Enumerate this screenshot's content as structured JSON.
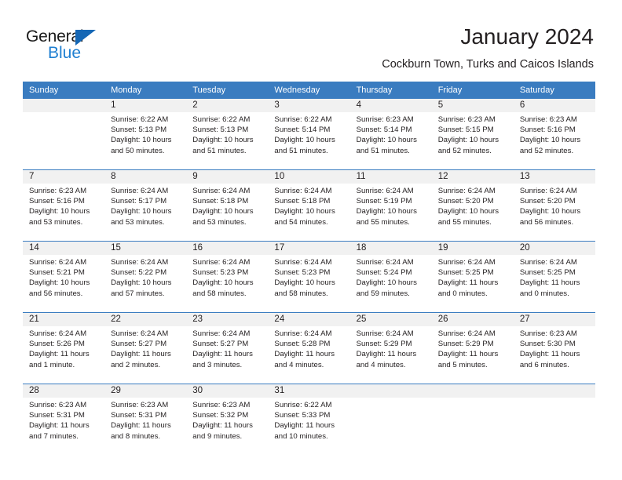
{
  "brand": {
    "name_top": "General",
    "name_bottom": "Blue",
    "triangle_color": "#1567b5",
    "blue_color": "#1f7fd1"
  },
  "header": {
    "title": "January 2024",
    "subtitle": "Cockburn Town, Turks and Caicos Islands"
  },
  "theme": {
    "header_row_bg": "#3a7cc0",
    "daynum_bg": "#f1f1f1",
    "text": "#231f20"
  },
  "weekday_headers": [
    "Sunday",
    "Monday",
    "Tuesday",
    "Wednesday",
    "Thursday",
    "Friday",
    "Saturday"
  ],
  "weeks": [
    [
      {
        "day": "",
        "sunrise": "",
        "sunset": "",
        "daylight_line1": "",
        "daylight_line2": ""
      },
      {
        "day": "1",
        "sunrise": "Sunrise: 6:22 AM",
        "sunset": "Sunset: 5:13 PM",
        "daylight_line1": "Daylight: 10 hours",
        "daylight_line2": "and 50 minutes."
      },
      {
        "day": "2",
        "sunrise": "Sunrise: 6:22 AM",
        "sunset": "Sunset: 5:13 PM",
        "daylight_line1": "Daylight: 10 hours",
        "daylight_line2": "and 51 minutes."
      },
      {
        "day": "3",
        "sunrise": "Sunrise: 6:22 AM",
        "sunset": "Sunset: 5:14 PM",
        "daylight_line1": "Daylight: 10 hours",
        "daylight_line2": "and 51 minutes."
      },
      {
        "day": "4",
        "sunrise": "Sunrise: 6:23 AM",
        "sunset": "Sunset: 5:14 PM",
        "daylight_line1": "Daylight: 10 hours",
        "daylight_line2": "and 51 minutes."
      },
      {
        "day": "5",
        "sunrise": "Sunrise: 6:23 AM",
        "sunset": "Sunset: 5:15 PM",
        "daylight_line1": "Daylight: 10 hours",
        "daylight_line2": "and 52 minutes."
      },
      {
        "day": "6",
        "sunrise": "Sunrise: 6:23 AM",
        "sunset": "Sunset: 5:16 PM",
        "daylight_line1": "Daylight: 10 hours",
        "daylight_line2": "and 52 minutes."
      }
    ],
    [
      {
        "day": "7",
        "sunrise": "Sunrise: 6:23 AM",
        "sunset": "Sunset: 5:16 PM",
        "daylight_line1": "Daylight: 10 hours",
        "daylight_line2": "and 53 minutes."
      },
      {
        "day": "8",
        "sunrise": "Sunrise: 6:24 AM",
        "sunset": "Sunset: 5:17 PM",
        "daylight_line1": "Daylight: 10 hours",
        "daylight_line2": "and 53 minutes."
      },
      {
        "day": "9",
        "sunrise": "Sunrise: 6:24 AM",
        "sunset": "Sunset: 5:18 PM",
        "daylight_line1": "Daylight: 10 hours",
        "daylight_line2": "and 53 minutes."
      },
      {
        "day": "10",
        "sunrise": "Sunrise: 6:24 AM",
        "sunset": "Sunset: 5:18 PM",
        "daylight_line1": "Daylight: 10 hours",
        "daylight_line2": "and 54 minutes."
      },
      {
        "day": "11",
        "sunrise": "Sunrise: 6:24 AM",
        "sunset": "Sunset: 5:19 PM",
        "daylight_line1": "Daylight: 10 hours",
        "daylight_line2": "and 55 minutes."
      },
      {
        "day": "12",
        "sunrise": "Sunrise: 6:24 AM",
        "sunset": "Sunset: 5:20 PM",
        "daylight_line1": "Daylight: 10 hours",
        "daylight_line2": "and 55 minutes."
      },
      {
        "day": "13",
        "sunrise": "Sunrise: 6:24 AM",
        "sunset": "Sunset: 5:20 PM",
        "daylight_line1": "Daylight: 10 hours",
        "daylight_line2": "and 56 minutes."
      }
    ],
    [
      {
        "day": "14",
        "sunrise": "Sunrise: 6:24 AM",
        "sunset": "Sunset: 5:21 PM",
        "daylight_line1": "Daylight: 10 hours",
        "daylight_line2": "and 56 minutes."
      },
      {
        "day": "15",
        "sunrise": "Sunrise: 6:24 AM",
        "sunset": "Sunset: 5:22 PM",
        "daylight_line1": "Daylight: 10 hours",
        "daylight_line2": "and 57 minutes."
      },
      {
        "day": "16",
        "sunrise": "Sunrise: 6:24 AM",
        "sunset": "Sunset: 5:23 PM",
        "daylight_line1": "Daylight: 10 hours",
        "daylight_line2": "and 58 minutes."
      },
      {
        "day": "17",
        "sunrise": "Sunrise: 6:24 AM",
        "sunset": "Sunset: 5:23 PM",
        "daylight_line1": "Daylight: 10 hours",
        "daylight_line2": "and 58 minutes."
      },
      {
        "day": "18",
        "sunrise": "Sunrise: 6:24 AM",
        "sunset": "Sunset: 5:24 PM",
        "daylight_line1": "Daylight: 10 hours",
        "daylight_line2": "and 59 minutes."
      },
      {
        "day": "19",
        "sunrise": "Sunrise: 6:24 AM",
        "sunset": "Sunset: 5:25 PM",
        "daylight_line1": "Daylight: 11 hours",
        "daylight_line2": "and 0 minutes."
      },
      {
        "day": "20",
        "sunrise": "Sunrise: 6:24 AM",
        "sunset": "Sunset: 5:25 PM",
        "daylight_line1": "Daylight: 11 hours",
        "daylight_line2": "and 0 minutes."
      }
    ],
    [
      {
        "day": "21",
        "sunrise": "Sunrise: 6:24 AM",
        "sunset": "Sunset: 5:26 PM",
        "daylight_line1": "Daylight: 11 hours",
        "daylight_line2": "and 1 minute."
      },
      {
        "day": "22",
        "sunrise": "Sunrise: 6:24 AM",
        "sunset": "Sunset: 5:27 PM",
        "daylight_line1": "Daylight: 11 hours",
        "daylight_line2": "and 2 minutes."
      },
      {
        "day": "23",
        "sunrise": "Sunrise: 6:24 AM",
        "sunset": "Sunset: 5:27 PM",
        "daylight_line1": "Daylight: 11 hours",
        "daylight_line2": "and 3 minutes."
      },
      {
        "day": "24",
        "sunrise": "Sunrise: 6:24 AM",
        "sunset": "Sunset: 5:28 PM",
        "daylight_line1": "Daylight: 11 hours",
        "daylight_line2": "and 4 minutes."
      },
      {
        "day": "25",
        "sunrise": "Sunrise: 6:24 AM",
        "sunset": "Sunset: 5:29 PM",
        "daylight_line1": "Daylight: 11 hours",
        "daylight_line2": "and 4 minutes."
      },
      {
        "day": "26",
        "sunrise": "Sunrise: 6:24 AM",
        "sunset": "Sunset: 5:29 PM",
        "daylight_line1": "Daylight: 11 hours",
        "daylight_line2": "and 5 minutes."
      },
      {
        "day": "27",
        "sunrise": "Sunrise: 6:23 AM",
        "sunset": "Sunset: 5:30 PM",
        "daylight_line1": "Daylight: 11 hours",
        "daylight_line2": "and 6 minutes."
      }
    ],
    [
      {
        "day": "28",
        "sunrise": "Sunrise: 6:23 AM",
        "sunset": "Sunset: 5:31 PM",
        "daylight_line1": "Daylight: 11 hours",
        "daylight_line2": "and 7 minutes."
      },
      {
        "day": "29",
        "sunrise": "Sunrise: 6:23 AM",
        "sunset": "Sunset: 5:31 PM",
        "daylight_line1": "Daylight: 11 hours",
        "daylight_line2": "and 8 minutes."
      },
      {
        "day": "30",
        "sunrise": "Sunrise: 6:23 AM",
        "sunset": "Sunset: 5:32 PM",
        "daylight_line1": "Daylight: 11 hours",
        "daylight_line2": "and 9 minutes."
      },
      {
        "day": "31",
        "sunrise": "Sunrise: 6:22 AM",
        "sunset": "Sunset: 5:33 PM",
        "daylight_line1": "Daylight: 11 hours",
        "daylight_line2": "and 10 minutes."
      },
      {
        "day": "",
        "sunrise": "",
        "sunset": "",
        "daylight_line1": "",
        "daylight_line2": ""
      },
      {
        "day": "",
        "sunrise": "",
        "sunset": "",
        "daylight_line1": "",
        "daylight_line2": ""
      },
      {
        "day": "",
        "sunrise": "",
        "sunset": "",
        "daylight_line1": "",
        "daylight_line2": ""
      }
    ]
  ]
}
